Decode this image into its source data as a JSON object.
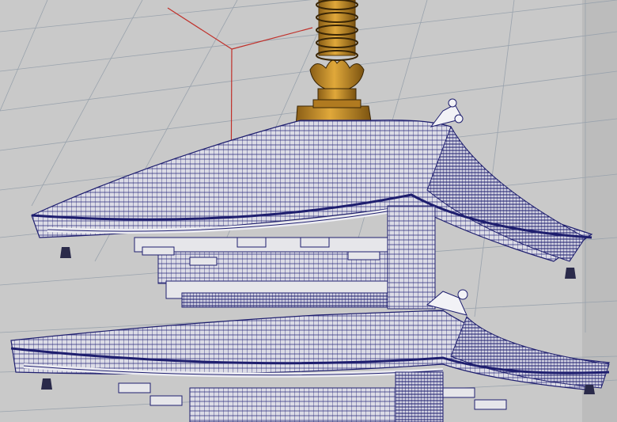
{
  "viewport": {
    "kind": "3d-modeling-perspective-viewport",
    "object": "pagoda-wireframe-shaded-model",
    "display_mode": "shaded-with-wireframe"
  },
  "colors": {
    "background": "#c9c9c9",
    "grid": "#9aa3ad",
    "wire": "#1e1e6e",
    "surface": "#e6e6ea",
    "gold": "#c8902a",
    "gold_dark": "#7a5412",
    "axis_red": "#c0302a"
  },
  "icons": {
    "axis_gizmo": "axis-gizmo-icon"
  }
}
